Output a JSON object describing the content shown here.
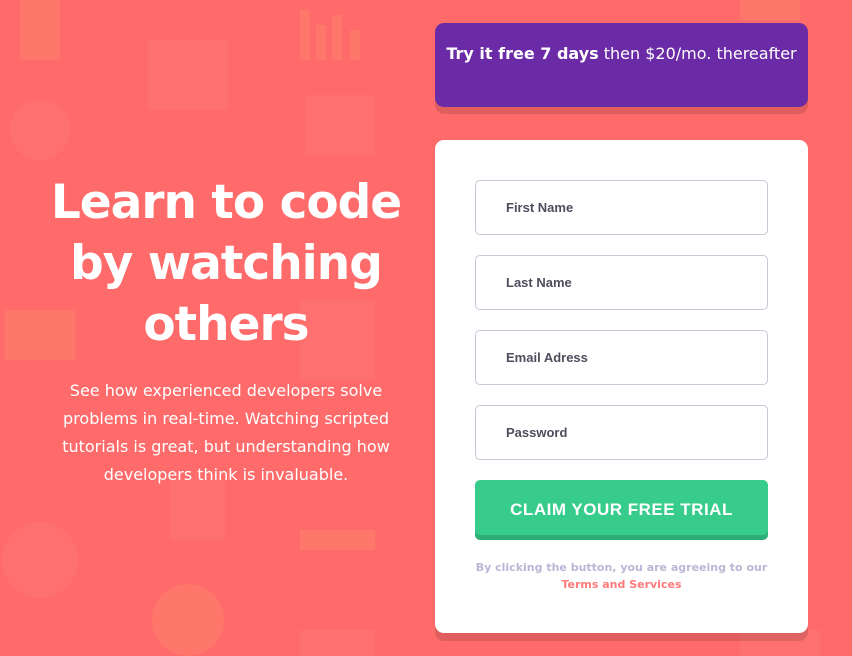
{
  "hero": {
    "title": "Learn to code by watching others",
    "description": "See how experienced developers solve problems in real-time. Watching scripted tutorials is great, but understanding how developers think is invaluable."
  },
  "promo": {
    "bold": "Try it free 7 days",
    "rest": " then $20/mo. thereafter"
  },
  "form": {
    "first_name_placeholder": "First Name",
    "last_name_placeholder": "Last Name",
    "email_placeholder": "Email Adress",
    "password_placeholder": "Password",
    "submit_label": "CLAIM YOUR FREE TRIAL",
    "terms_text": "By clicking the button, you are agreeing to our",
    "terms_link": "Terms and Services"
  },
  "colors": {
    "background": "#ff6b6b",
    "promo": "#6b2ba6",
    "button": "#38cc8c",
    "terms_link": "#ff7a7a"
  }
}
